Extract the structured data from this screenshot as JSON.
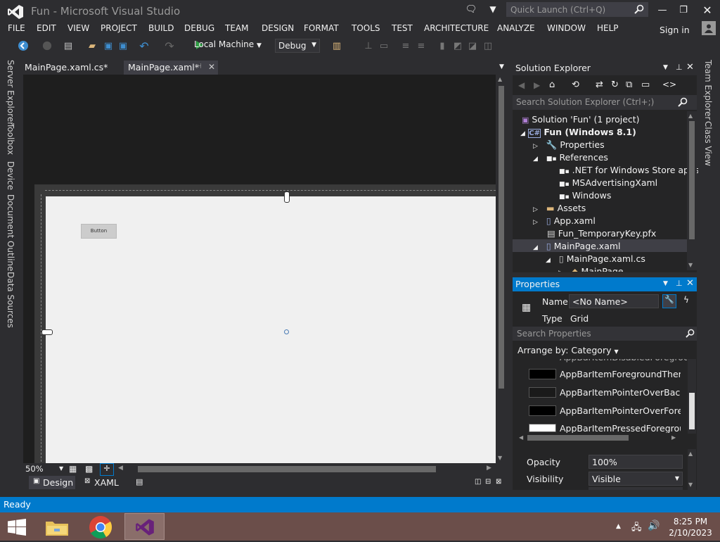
{
  "window": {
    "title": "Fun - Microsoft Visual Studio",
    "quick_launch_placeholder": "Quick Launch (Ctrl+Q)"
  },
  "menu": {
    "items": [
      "FILE",
      "EDIT",
      "VIEW",
      "PROJECT",
      "BUILD",
      "DEBUG",
      "TEAM",
      "DESIGN",
      "FORMAT",
      "TOOLS",
      "TEST",
      "ARCHITECTURE",
      "ANALYZE",
      "WINDOW",
      "HELP"
    ],
    "sign_in": "Sign in"
  },
  "toolbar": {
    "run_target": "Local Machine",
    "configuration": "Debug"
  },
  "left_strip": [
    "Server Explorer",
    "Toolbox",
    "Device",
    "Document Outline",
    "Data Sources"
  ],
  "right_strip": [
    "Team Explorer",
    "Class View"
  ],
  "doc_tabs": [
    {
      "label": "MainPage.xaml.cs*",
      "active": false
    },
    {
      "label": "MainPage.xaml*",
      "active": true
    }
  ],
  "designer": {
    "button_label": "Button",
    "zoom": "50%",
    "view_tabs": [
      "Design",
      "XAML"
    ]
  },
  "solution_explorer": {
    "title": "Solution Explorer",
    "search_placeholder": "Search Solution Explorer (Ctrl+;)",
    "tree": [
      {
        "label": "Solution 'Fun' (1 project)",
        "depth": 0,
        "bold": false
      },
      {
        "label": "Fun (Windows 8.1)",
        "depth": 1,
        "bold": true
      },
      {
        "label": "Properties",
        "depth": 2
      },
      {
        "label": "References",
        "depth": 2
      },
      {
        "label": ".NET for Windows Store apps",
        "depth": 3
      },
      {
        "label": "MSAdvertisingXaml",
        "depth": 3
      },
      {
        "label": "Windows",
        "depth": 3
      },
      {
        "label": "Assets",
        "depth": 2
      },
      {
        "label": "App.xaml",
        "depth": 2
      },
      {
        "label": "Fun_TemporaryKey.pfx",
        "depth": 2
      },
      {
        "label": "MainPage.xaml",
        "depth": 2,
        "selected": true
      },
      {
        "label": "MainPage.xaml.cs",
        "depth": 3
      },
      {
        "label": "MainPage",
        "depth": 4
      }
    ]
  },
  "properties": {
    "title": "Properties",
    "name_label": "Name",
    "name_value": "<No Name>",
    "type_label": "Type",
    "type_value": "Grid",
    "search_placeholder": "Search Properties",
    "arrange_by": "Arrange by: Category",
    "brushes": [
      {
        "label": "AppBarItemForegroundThemeBrush",
        "color": "#000000"
      },
      {
        "label": "AppBarItemPointerOverBackgroundThemeBrush",
        "color": "#1a1a1a"
      },
      {
        "label": "AppBarItemPointerOverForegroundThemeBrush",
        "color": "#000000"
      },
      {
        "label": "AppBarItemPressedForegroundThemeBrush",
        "color": "#ffffff"
      }
    ],
    "opacity_label": "Opacity",
    "opacity_value": "100%",
    "visibility_label": "Visibility",
    "visibility_value": "Visible"
  },
  "status": {
    "text": "Ready"
  },
  "taskbar": {
    "time": "8:25 PM",
    "date": "2/10/2023"
  }
}
